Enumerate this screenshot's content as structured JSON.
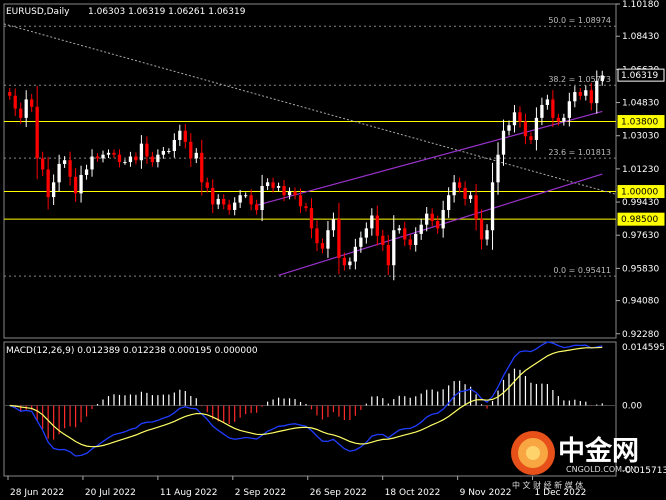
{
  "header": {
    "symbol": "EURUSD,Daily",
    "ohlc": "1.06303 1.06319 1.06261 1.06319"
  },
  "chart_data": [
    {
      "type": "candlestick",
      "title": "EURUSD,Daily",
      "ylim": [
        0.9205,
        1.1018
      ],
      "y_ticks": [
        "1.10180",
        "1.08430",
        "1.06630",
        "1.04830",
        "1.03030",
        "1.01230",
        "0.99430",
        "0.97630",
        "0.95830",
        "0.94080",
        "0.92280"
      ],
      "x_ticks": [
        "28 Jun 2022",
        "20 Jul 2022",
        "11 Aug 2022",
        "2 Sep 2022",
        "26 Sep 2022",
        "18 Oct 2022",
        "9 Nov 2022",
        "1 Dec 2022"
      ],
      "price_labels": [
        {
          "value": 1.06319,
          "text": "1.06319",
          "color": "#ffffff"
        },
        {
          "value": 1.038,
          "text": "1.03800",
          "color": "#ffff00"
        },
        {
          "value": 1.0,
          "text": "1.00000",
          "color": "#ffff00"
        },
        {
          "value": 0.985,
          "text": "0.98500",
          "color": "#ffff00"
        }
      ],
      "fibonacci": [
        {
          "text": "50.0 = 1.08974",
          "value": 1.08974
        },
        {
          "text": "38.2 = 1.05773",
          "value": 1.05773
        },
        {
          "text": "23.6 = 1.01813",
          "value": 1.01813
        },
        {
          "text": "0.0 = 0.95411",
          "value": 0.95411
        }
      ],
      "horizontal_lines": [
        1.038,
        1.0,
        0.985
      ],
      "closes": [
        1.052,
        1.045,
        1.04,
        1.05,
        1.046,
        1.018,
        1.012,
        0.997,
        1.005,
        1.015,
        1.017,
        1.008,
        0.999,
        1.009,
        1.012,
        1.019,
        1.018,
        1.02,
        1.021,
        1.02,
        1.016,
        1.016,
        1.019,
        1.017,
        1.026,
        1.019,
        1.016,
        1.02,
        1.022,
        1.022,
        1.028,
        1.033,
        1.027,
        1.018,
        1.021,
        1.005,
        1.002,
        0.993,
        0.996,
        0.993,
        0.99,
        0.994,
        0.998,
        0.998,
        0.993,
        0.99,
        1.003,
        1.005,
        1.002,
        1.003,
        0.998,
        1.0,
        0.998,
        0.992,
        0.991,
        0.98,
        0.972,
        0.969,
        0.979,
        0.985,
        0.964,
        0.96,
        0.962,
        0.97,
        0.975,
        0.98,
        0.987,
        0.976,
        0.971,
        0.96,
        0.979,
        0.98,
        0.974,
        0.971,
        0.977,
        0.982,
        0.988,
        0.984,
        0.98,
        0.99,
        0.998,
        1.005,
        1.002,
        0.996,
        0.998,
        0.985,
        0.974,
        0.979,
        1.005,
        1.02,
        1.033,
        1.036,
        1.043,
        1.038,
        1.03,
        1.028,
        1.04,
        1.047,
        1.05,
        1.04,
        1.038,
        1.04,
        1.049,
        1.054,
        1.052,
        1.055,
        1.048,
        1.06,
        1.063
      ]
    },
    {
      "type": "macd",
      "title": "MACD(12,26,9) 0.012389 0.012238 0.000195 0.000000",
      "params": [
        12,
        26,
        9
      ],
      "y_ticks": [
        "0.014595",
        "0.00",
        "-0.015713"
      ],
      "ylim": [
        -0.0172,
        0.0155
      ]
    }
  ],
  "watermark": {
    "text": "中金网",
    "domain": "CNGOLD.COM.CN",
    "slogan": "中 文 财 经 新 媒 体"
  },
  "colors": {
    "bull": "#ffffff",
    "bear": "#ff0000",
    "grid": "#666666",
    "fib": "#888888",
    "level": "#ffff00",
    "channel": "#9932cc",
    "macd": "#1f3cff",
    "signal": "#ffff66",
    "hist_pos": "#ffffff",
    "hist_neg": "#ff2a2a"
  }
}
